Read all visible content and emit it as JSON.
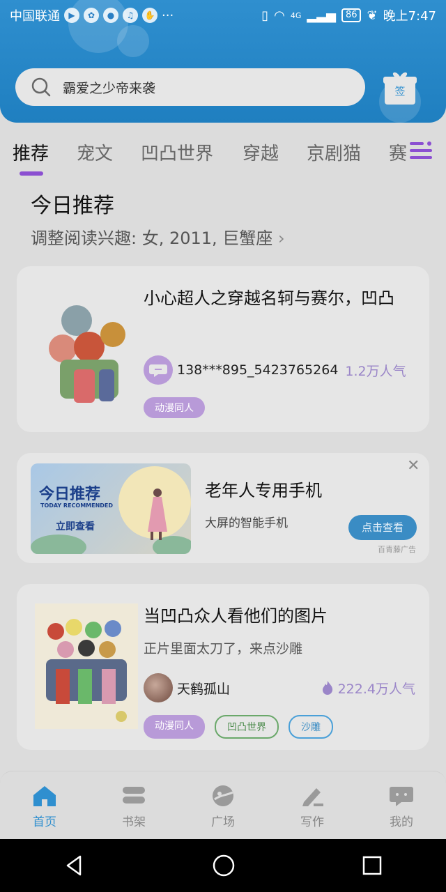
{
  "status_bar": {
    "carrier": "中国联通",
    "network": "4G",
    "battery": "86",
    "time": "晚上7:47"
  },
  "search": {
    "placeholder": "霸爱之少帝来袭"
  },
  "checkin": {
    "label": "签"
  },
  "tabs": [
    {
      "label": "推荐",
      "active": true
    },
    {
      "label": "宠文"
    },
    {
      "label": "凹凸世界"
    },
    {
      "label": "穿越"
    },
    {
      "label": "京剧猫"
    },
    {
      "label": "赛"
    }
  ],
  "section": {
    "title": "今日推荐",
    "subtitle": "调整阅读兴趣: 女, 2011, 巨蟹座"
  },
  "cards": [
    {
      "title": "小心超人之穿越名轲与赛尔，凹凸",
      "author": "138***895_5423765264",
      "popularity": "1.2万人气",
      "tags": [
        "动漫同人"
      ]
    },
    {
      "title": "当凹凸众人看他们的图片",
      "description": "正片里面太刀了，来点沙雕",
      "author": "天鹤孤山",
      "popularity": "222.4万人气",
      "tags": [
        "动漫同人",
        "凹凸世界",
        "沙雕"
      ]
    }
  ],
  "ad": {
    "image_title": "今日推荐",
    "image_subtitle": "TODAY RECOMMENDED",
    "image_cta": "立即查看",
    "title": "老年人专用手机",
    "description": "大屏的智能手机",
    "button": "点击查看",
    "source": "百青藤广告"
  },
  "bottom_nav": [
    {
      "label": "首页",
      "icon": "home-icon",
      "active": true
    },
    {
      "label": "书架",
      "icon": "bookshelf-icon"
    },
    {
      "label": "广场",
      "icon": "plaza-icon"
    },
    {
      "label": "写作",
      "icon": "write-icon"
    },
    {
      "label": "我的",
      "icon": "profile-icon"
    }
  ],
  "colors": {
    "header_blue": "#2f8fcf",
    "accent_purple": "#8b4fd1",
    "tag_purple": "#b89ad8"
  }
}
